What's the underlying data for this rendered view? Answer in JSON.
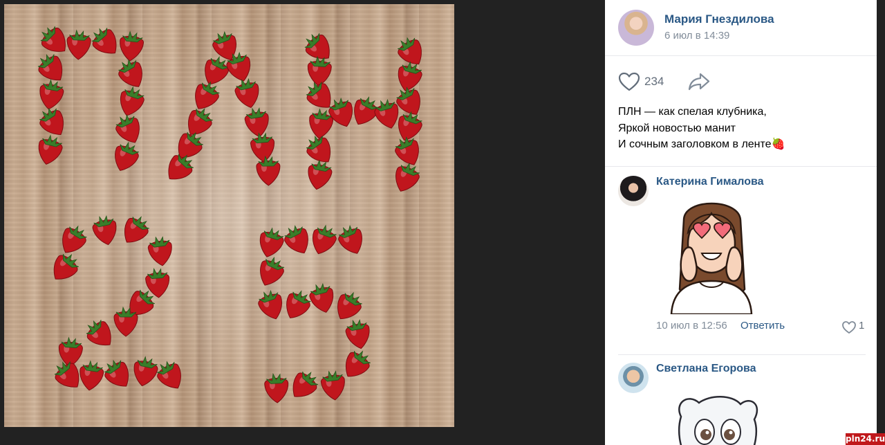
{
  "post": {
    "author_name": "Мария Гнездилова",
    "date": "6 июл в 14:39",
    "likes": "234",
    "text_lines": [
      "ПЛН — как спелая клубника,",
      "Яркой новостью манит",
      "И сочным заголовком в ленте🍓"
    ]
  },
  "photo": {
    "letters": "ПЛН",
    "digits": "25"
  },
  "comments": [
    {
      "author_name": "Катерина Гималова",
      "date": "10 июл в 12:56",
      "reply_label": "Ответить",
      "likes": "1"
    },
    {
      "author_name": "Светлана Егорова"
    }
  ],
  "watermark": "pln24.ru",
  "colors": {
    "link": "#2a5885",
    "secondary": "#818c99",
    "strawberry": "#c0161d",
    "leaf": "#3a7d2a"
  }
}
